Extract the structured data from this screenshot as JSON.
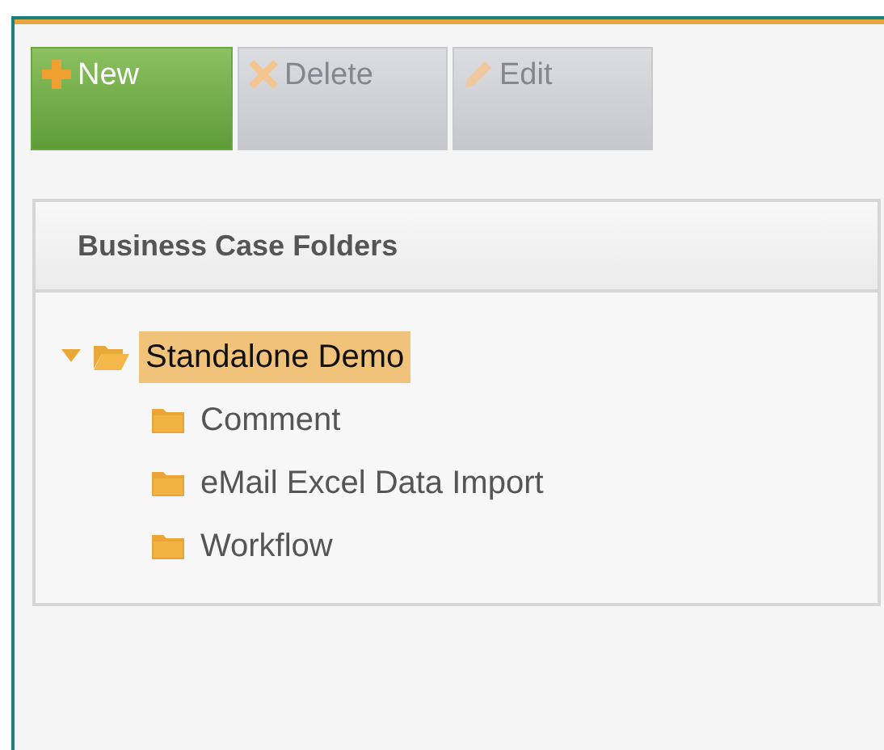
{
  "toolbar": [
    {
      "kind": "add",
      "label": "New",
      "disabled": false
    },
    {
      "kind": "delete",
      "label": "Delete",
      "disabled": true
    },
    {
      "kind": "edit",
      "label": "Edit",
      "disabled": true
    }
  ],
  "panel": {
    "title": "Business Case Folders",
    "tree": [
      {
        "label": "Standalone Demo",
        "expanded": true,
        "selected": true,
        "children": [
          {
            "label": "Comment",
            "selected": false
          },
          {
            "label": "eMail Excel Data Import",
            "selected": false
          },
          {
            "label": "Workflow",
            "selected": false
          }
        ]
      }
    ]
  }
}
